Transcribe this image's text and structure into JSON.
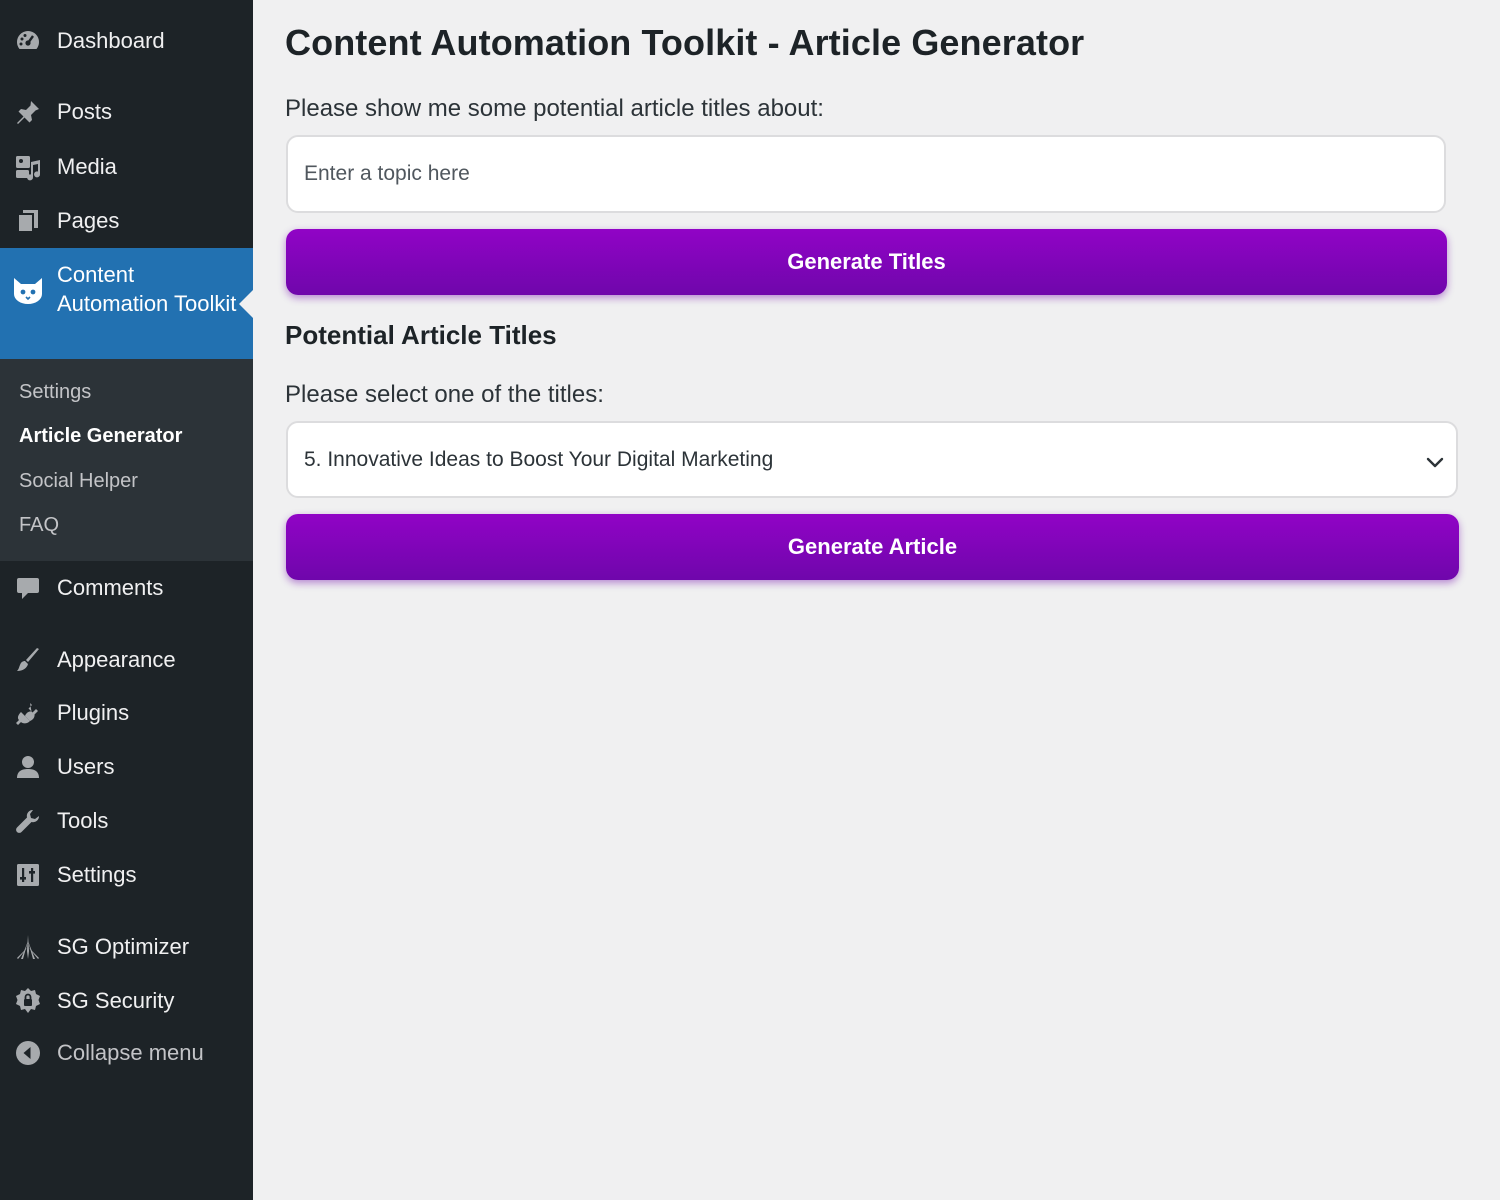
{
  "sidebar": {
    "items": [
      {
        "label": "Dashboard",
        "icon": "dashboard-icon"
      },
      {
        "label": "Posts",
        "icon": "pin-icon"
      },
      {
        "label": "Media",
        "icon": "media-icon"
      },
      {
        "label": "Pages",
        "icon": "pages-icon"
      },
      {
        "label": "Content Automation Toolkit",
        "icon": "cat-face-icon"
      },
      {
        "label": "Comments",
        "icon": "comment-icon"
      },
      {
        "label": "Appearance",
        "icon": "brush-icon"
      },
      {
        "label": "Plugins",
        "icon": "plug-icon"
      },
      {
        "label": "Users",
        "icon": "user-icon"
      },
      {
        "label": "Tools",
        "icon": "wrench-icon"
      },
      {
        "label": "Settings",
        "icon": "sliders-icon"
      },
      {
        "label": "SG Optimizer",
        "icon": "sg-optimizer-icon"
      },
      {
        "label": "SG Security",
        "icon": "sg-security-icon"
      }
    ],
    "submenu": [
      {
        "label": "Settings"
      },
      {
        "label": "Article Generator"
      },
      {
        "label": "Social Helper"
      },
      {
        "label": "FAQ"
      }
    ],
    "collapse_label": "Collapse menu",
    "active_color": "#2271b1"
  },
  "main": {
    "title": "Content Automation Toolkit - Article Generator",
    "topic_prompt": "Please show me some potential article titles about:",
    "topic_input": {
      "value": "",
      "placeholder": "Enter a topic here"
    },
    "generate_titles_label": "Generate Titles",
    "section_heading": "Potential Article Titles",
    "select_prompt": "Please select one of the titles:",
    "selected_title": "5. Innovative Ideas to Boost Your Digital Marketing",
    "generate_article_label": "Generate Article",
    "button_color": "#8a05c0"
  }
}
